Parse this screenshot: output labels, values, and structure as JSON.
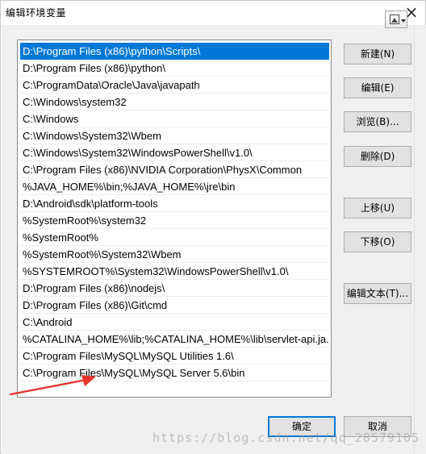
{
  "window": {
    "title": "编辑环境变量",
    "close_glyph": "×"
  },
  "path_list": {
    "selected_index": 0,
    "items": [
      "D:\\Program Files (x86)\\python\\Scripts\\",
      "D:\\Program Files (x86)\\python\\",
      "C:\\ProgramData\\Oracle\\Java\\javapath",
      "C:\\Windows\\system32",
      "C:\\Windows",
      "C:\\Windows\\System32\\Wbem",
      "C:\\Windows\\System32\\WindowsPowerShell\\v1.0\\",
      "C:\\Program Files (x86)\\NVIDIA Corporation\\PhysX\\Common",
      "%JAVA_HOME%\\bin;%JAVA_HOME%\\jre\\bin",
      "D:\\Android\\sdk\\platform-tools",
      "%SystemRoot%\\system32",
      "%SystemRoot%",
      "%SystemRoot%\\System32\\Wbem",
      "%SYSTEMROOT%\\System32\\WindowsPowerShell\\v1.0\\",
      "D:\\Program Files (x86)\\nodejs\\",
      "D:\\Program Files (x86)\\Git\\cmd",
      "C:\\Android",
      "%CATALINA_HOME%\\lib;%CATALINA_HOME%\\lib\\servlet-api.ja...",
      "C:\\Program Files\\MySQL\\MySQL Utilities 1.6\\",
      "C:\\Program Files\\MySQL\\MySQL Server 5.6\\bin"
    ]
  },
  "buttons": {
    "new": "新建(N)",
    "edit": "编辑(E)",
    "browse": "浏览(B)...",
    "delete": "删除(D)",
    "move_up": "上移(U)",
    "move_down": "下移(O)",
    "edit_text": "编辑文本(T)...",
    "ok": "确定",
    "cancel": "取消"
  },
  "icons": {
    "extra": "image-dropdown-icon",
    "close": "close-icon",
    "annotation": "red-arrow-annotation"
  },
  "colors": {
    "selection": "#0078d7",
    "annotation_arrow": "#e8332a",
    "dialog_bg": "#f0f0f0"
  },
  "watermark": "https://blog.csdn.net/qq_28579105"
}
